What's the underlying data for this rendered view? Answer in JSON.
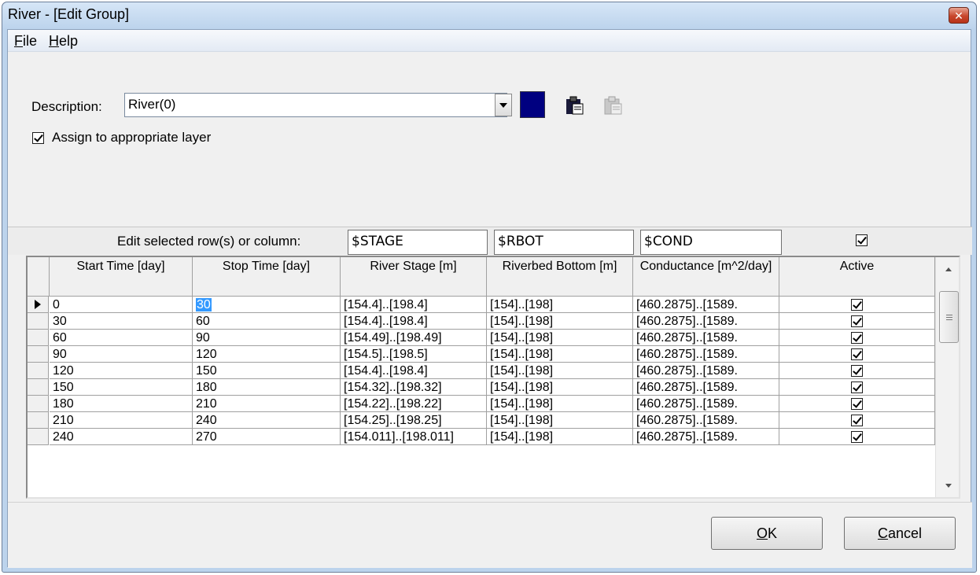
{
  "window": {
    "title": "River - [Edit Group]"
  },
  "menu": [
    {
      "accel": "F",
      "rest": "ile"
    },
    {
      "accel": "H",
      "rest": "elp"
    }
  ],
  "description": {
    "label": "Description:",
    "value": "River(0)"
  },
  "assign": {
    "label": "Assign to appropriate layer",
    "checked": true
  },
  "edit_bar": {
    "label": "Edit selected row(s) or column:",
    "stage": "$STAGE",
    "rbot": "$RBOT",
    "cond": "$COND",
    "active_checked": true
  },
  "table": {
    "headers": {
      "start": "Start Time [day]",
      "stop": "Stop Time [day]",
      "stage": "River Stage [m]",
      "rbot": "Riverbed Bottom [m]",
      "cond": "Conductance [m^2/day]",
      "active": "Active"
    },
    "rows": [
      {
        "start": "0",
        "stop": "30",
        "stage": "[154.4]..[198.4]",
        "rbot": "[154]..[198]",
        "cond": "[460.2875]..[1589.",
        "active": true
      },
      {
        "start": "30",
        "stop": "60",
        "stage": "[154.4]..[198.4]",
        "rbot": "[154]..[198]",
        "cond": "[460.2875]..[1589.",
        "active": true
      },
      {
        "start": "60",
        "stop": "90",
        "stage": "[154.49]..[198.49]",
        "rbot": "[154]..[198]",
        "cond": "[460.2875]..[1589.",
        "active": true
      },
      {
        "start": "90",
        "stop": "120",
        "stage": "[154.5]..[198.5]",
        "rbot": "[154]..[198]",
        "cond": "[460.2875]..[1589.",
        "active": true
      },
      {
        "start": "120",
        "stop": "150",
        "stage": "[154.4]..[198.4]",
        "rbot": "[154]..[198]",
        "cond": "[460.2875]..[1589.",
        "active": true
      },
      {
        "start": "150",
        "stop": "180",
        "stage": "[154.32]..[198.32]",
        "rbot": "[154]..[198]",
        "cond": "[460.2875]..[1589.",
        "active": true
      },
      {
        "start": "180",
        "stop": "210",
        "stage": "[154.22]..[198.22]",
        "rbot": "[154]..[198]",
        "cond": "[460.2875]..[1589.",
        "active": true
      },
      {
        "start": "210",
        "stop": "240",
        "stage": "[154.25]..[198.25]",
        "rbot": "[154]..[198]",
        "cond": "[460.2875]..[1589.",
        "active": true
      },
      {
        "start": "240",
        "stop": "270",
        "stage": "[154.011]..[198.011]",
        "rbot": "[154]..[198]",
        "cond": "[460.2875]..[1589.",
        "active": true
      }
    ]
  },
  "buttons": {
    "ok": {
      "accel": "O",
      "rest": "K"
    },
    "cancel": {
      "accel": "C",
      "rest": "ancel"
    }
  },
  "colors": {
    "swatch": "#000080",
    "selection": "#3399ff"
  },
  "icons": [
    "close-icon",
    "dropdown-arrow-icon",
    "paste-icon",
    "paste-disabled-icon",
    "current-row-arrow-icon",
    "scroll-up-icon",
    "scroll-down-icon"
  ]
}
